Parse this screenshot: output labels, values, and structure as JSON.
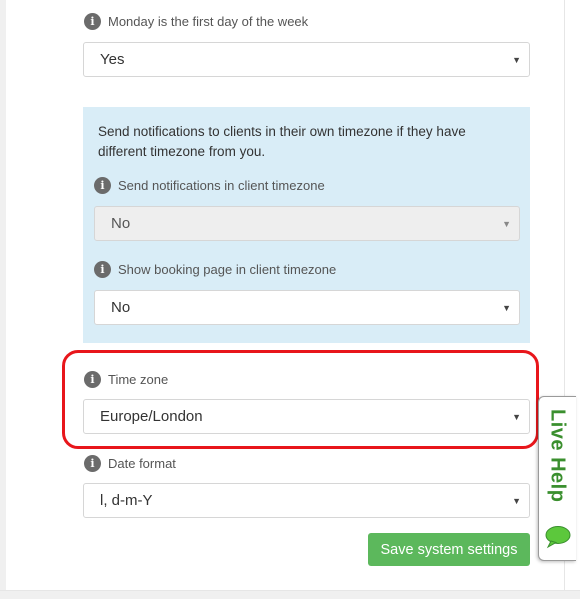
{
  "first_day": {
    "label": "Monday is the first day of the week",
    "value": "Yes"
  },
  "client_timezone_panel": {
    "description": "Send notifications to clients in their own timezone if they have different timezone from you.",
    "notifications": {
      "label": "Send notifications in client timezone",
      "value": "No"
    },
    "booking_page": {
      "label": "Show booking page in client timezone",
      "value": "No"
    }
  },
  "time_zone": {
    "label": "Time zone",
    "value": "Europe/London"
  },
  "date_format": {
    "label": "Date format",
    "value": "l, d-m-Y"
  },
  "save_button": "Save system settings",
  "live_help": "Live Help",
  "info_glyph": "i",
  "caret_glyph": "▼",
  "colors": {
    "accent_green": "#5cb85c",
    "info_panel": "#d9edf7",
    "highlight_red": "#e8161b",
    "live_help_green": "#3a8f2e"
  }
}
